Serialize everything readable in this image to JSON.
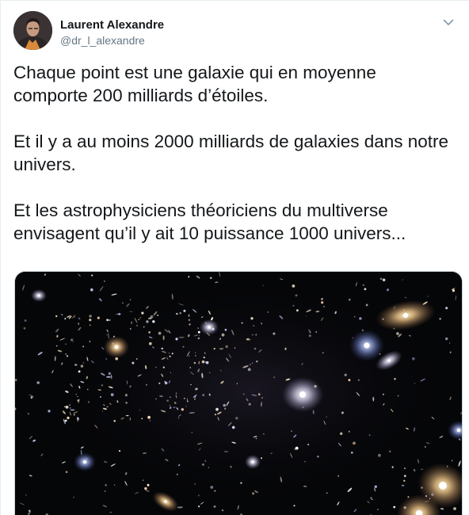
{
  "author": {
    "name": "Laurent Alexandre",
    "handle": "@dr_l_alexandre",
    "avatar_icon": "profile-photo"
  },
  "menu": {
    "icon": "chevron-down-icon"
  },
  "tweet": {
    "paragraphs": [
      "Chaque point est une galaxie qui en moyenne\ncomporte 200 milliards d’étoiles.",
      "Et il y a au moins 2000 milliards de galaxies dans notre\nunivers.",
      "Et les astrophysiciens théoriciens du multiverse\nenvisagent qu’il y ait 10 puissance 1000 univers..."
    ]
  },
  "media": {
    "type": "image",
    "subject": "deep-field-galaxies",
    "background_color": "#050608"
  },
  "colors": {
    "text": "#14171a",
    "secondary": "#657786",
    "border": "#e6ecf0"
  }
}
